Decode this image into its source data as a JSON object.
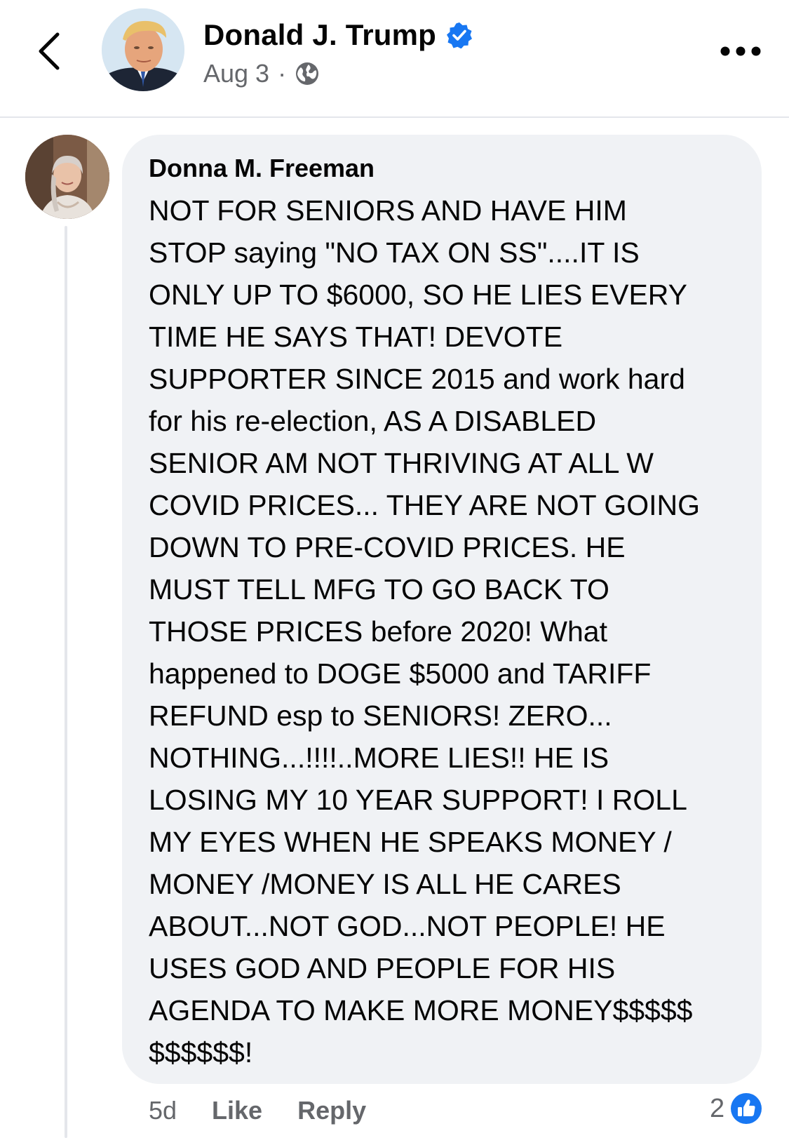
{
  "header": {
    "page_name": "Donald J. Trump",
    "date": "Aug 3",
    "separator": "·",
    "icons": [
      "back-chevron-icon",
      "verified-badge-icon",
      "globe-icon",
      "more-options-icon"
    ]
  },
  "comment": {
    "author": "Donna M. Freeman",
    "lines": [
      "NOT FOR SENIORS AND HAVE HIM",
      "STOP saying \"NO TAX ON SS\"....IT IS",
      "ONLY UP TO $6000, SO HE LIES EVERY",
      "TIME HE SAYS THAT! DEVOTE",
      "SUPPORTER SINCE 2015 and work hard",
      "for his re-election, AS A DISABLED",
      "SENIOR AM NOT THRIVING AT ALL W",
      "COVID PRICES... THEY ARE NOT GOING",
      "DOWN TO PRE-COVID PRICES. HE",
      "MUST TELL MFG TO GO BACK TO",
      "THOSE PRICES before 2020! What",
      "happened to DOGE $5000 and TARIFF",
      "REFUND esp to SENIORS! ZERO...",
      "NOTHING...!!!!..MORE LIES!! HE IS",
      "LOSING MY 10 YEAR SUPPORT! I ROLL",
      "MY EYES WHEN HE SPEAKS MONEY /",
      "MONEY /MONEY IS ALL HE CARES",
      "ABOUT...NOT GOD...NOT PEOPLE! HE",
      "USES GOD AND PEOPLE FOR HIS",
      "AGENDA TO MAKE MORE MONEY$$$$$",
      "$$$$$$!"
    ],
    "time": "5d",
    "like_label": "Like",
    "reply_label": "Reply",
    "reaction_count": "2"
  },
  "colors": {
    "accent": "#1877f2",
    "bubble": "#f0f2f5",
    "muted_text": "#65676b",
    "text": "#050505"
  }
}
